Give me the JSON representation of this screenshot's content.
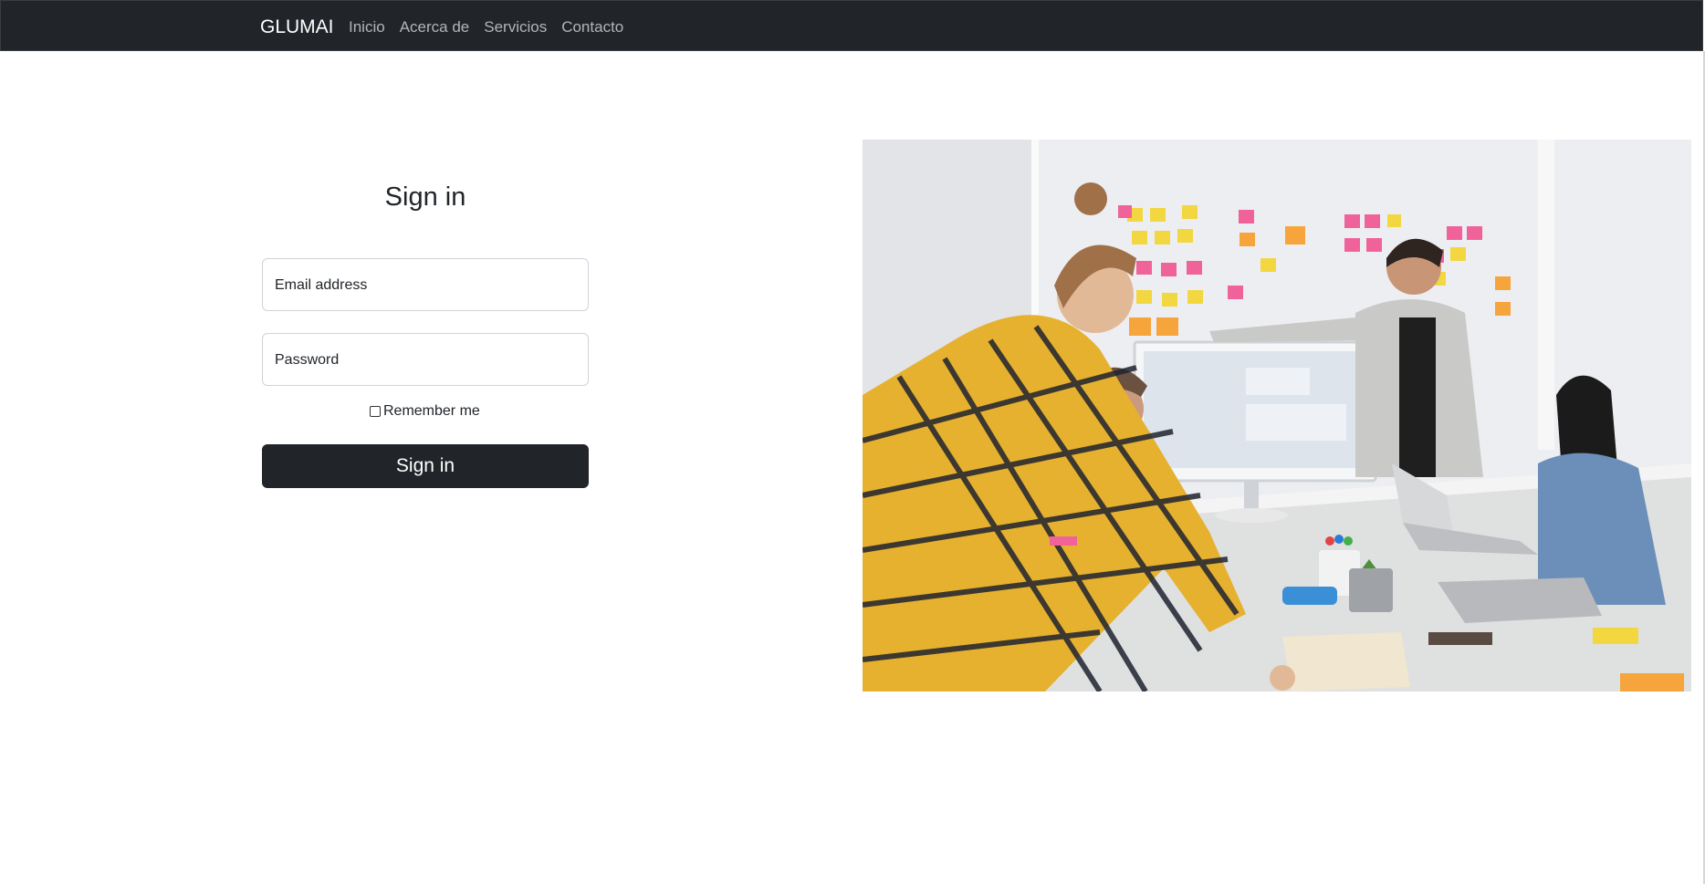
{
  "navbar": {
    "brand": "GLUMAI",
    "links": [
      "Inicio",
      "Acerca de",
      "Servicios",
      "Contacto"
    ]
  },
  "signin": {
    "title": "Sign in",
    "email_placeholder": "Email address",
    "password_placeholder": "Password",
    "remember_label": "Remember me",
    "remember_checked": false,
    "submit_label": "Sign in"
  },
  "hero": {
    "description_icon": "team-meeting-photo"
  },
  "colors": {
    "navbar_bg": "#212529",
    "button_bg": "#212529",
    "page_bg": "#ffffff"
  }
}
